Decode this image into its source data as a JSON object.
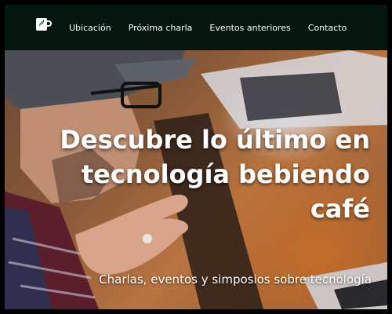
{
  "nav": {
    "logo_icon": "coffee-cup-icon",
    "items": [
      {
        "label": "Ubicación"
      },
      {
        "label": "Próxima charla"
      },
      {
        "label": "Eventos anteriores"
      },
      {
        "label": "Contacto"
      }
    ]
  },
  "hero": {
    "title_line1": "Descubre lo último en",
    "title_line2": "tecnología bebiendo",
    "title_line3": "café",
    "subtitle": "Charlas, eventos y simposios sobre tecnología"
  },
  "colors": {
    "navbar_bg": "#05160f",
    "text": "#ffffff"
  }
}
